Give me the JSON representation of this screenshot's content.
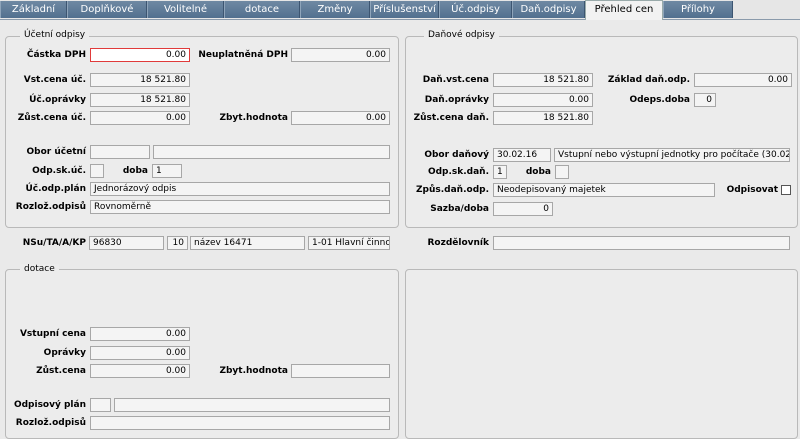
{
  "tabs": [
    "Základní",
    "Doplňkové",
    "Volitelné",
    "dotace",
    "Změny",
    "Příslušenství",
    "Úč.odpisy",
    "Daň.odpisy",
    "Přehled cen",
    "Přílohy"
  ],
  "accounting": {
    "title": "Účetní odpisy",
    "castka_dph_label": "Částka DPH",
    "castka_dph": "0.00",
    "neuplatnena_dph_label": "Neuplatněná DPH",
    "neuplatnena_dph": "0.00",
    "vst_cena_label": "Vst.cena úč.",
    "vst_cena": "18 521.80",
    "opravky_label": "Úč.oprávky",
    "opravky": "18 521.80",
    "zust_cena_label": "Zůst.cena úč.",
    "zust_cena": "0.00",
    "zbyt_hodnota_label": "Zbyt.hodnota",
    "zbyt_hodnota": "0.00",
    "obor_label": "Obor účetní",
    "obor_code": "",
    "obor_name": "",
    "odp_sk_label": "Odp.sk.úč.",
    "odp_sk": "",
    "doba_label": "doba",
    "doba": "1",
    "odp_plan_label": "Úč.odp.plán",
    "odp_plan": "Jednorázový odpis",
    "rozloz_label": "Rozlož.odpisů",
    "rozloz": "Rovnoměrně"
  },
  "tax": {
    "title": "Daňové odpisy",
    "vst_cena_label": "Daň.vst.cena",
    "vst_cena": "18 521.80",
    "zaklad_label": "Základ daň.odp.",
    "zaklad": "0.00",
    "opravky_label": "Daň.oprávky",
    "opravky": "0.00",
    "odeps_doba_label": "Odeps.doba",
    "odeps_doba": "0",
    "zust_cena_label": "Zůst.cena daň.",
    "zust_cena": "18 521.80",
    "obor_label": "Obor daňový",
    "obor_code": "30.02.16",
    "obor_name": "Vstupní nebo výstupní jednotky pro počítače (30.02.16)",
    "odp_sk_label": "Odp.sk.daň.",
    "odp_sk": "1",
    "doba_label": "doba",
    "doba": "",
    "zpusob_label": "Způs.daň.odp.",
    "zpusob": "Neodepisovaný majetek",
    "odpisovat_label": "Odpisovat",
    "sazba_label": "Sazba/doba",
    "sazba": "0"
  },
  "nsu": {
    "label": "NSu/TA/A/KP",
    "v1": "96830",
    "v2": "10",
    "v3": "název 16471",
    "v4": "1-01 Hlavní činnost",
    "rozdelovnik_label": "Rozdělovník",
    "rozdelovnik": ""
  },
  "dotace": {
    "title": "dotace",
    "vst_cena_label": "Vstupní cena",
    "vst_cena": "0.00",
    "opravky_label": "Oprávky",
    "opravky": "0.00",
    "zust_cena_label": "Zůst.cena",
    "zust_cena": "0.00",
    "zbyt_hodnota_label": "Zbyt.hodnota",
    "zbyt_hodnota": "",
    "odp_plan_label": "Odpisový plán",
    "odp_plan_code": "",
    "odp_plan": "",
    "rozloz_label": "Rozlož.odpisů",
    "rozloz": ""
  }
}
